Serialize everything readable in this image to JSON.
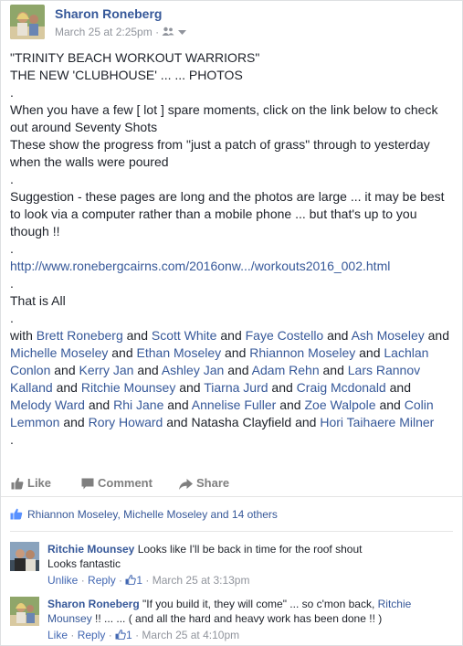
{
  "post": {
    "author": "Sharon Roneberg",
    "timestamp": "March 25 at 2:25pm",
    "privacy_sep": "·",
    "line1": "\"TRINITY BEACH WORKOUT WARRIORS\"",
    "line2": "THE NEW 'CLUBHOUSE' ... ... PHOTOS",
    "dot": ".",
    "para1": "When you have a few [ lot ] spare moments, click on the link below to check out around Seventy Shots",
    "para2": "These show the progress from \"just a patch of grass\" through to yesterday when the walls were poured",
    "para3": "Suggestion - these pages are long and the photos are large ... it may be best to look via a computer rather than a mobile phone ... but that's up to you though !!",
    "url": "http://www.ronebergcairns.com/2016onw.../workouts2016_002.html",
    "closing": "That is All",
    "with_label": "with",
    "and": "and",
    "tagged": [
      "Brett Roneberg",
      "Scott White",
      "Faye Costello",
      "Ash Moseley",
      "Michelle Moseley",
      "Ethan Moseley",
      "Rhiannon Moseley",
      "Lachlan Conlon",
      "Kerry Jan",
      "Ashley Jan",
      "Adam Rehn",
      "Lars Rannov Kalland",
      "Ritchie Mounsey",
      "Tiarna Jurd",
      "Craig Mcdonald",
      "Melody Ward",
      "Rhi Jane",
      "Annelise Fuller",
      "Zoe Walpole",
      "Colin Lemmon",
      "Rory Howard",
      "Natasha Clayfield",
      "Hori Taihaere Milner"
    ]
  },
  "actions": {
    "like": "Like",
    "comment": "Comment",
    "share": "Share"
  },
  "likes_summary": "Rhiannon Moseley, Michelle Moseley and 14 others",
  "comments": [
    {
      "name": "Ritchie Mounsey",
      "text1": "Looks like I'll be back in time for the roof shout",
      "text2": "Looks fantastic",
      "unlike": "Unlike",
      "reply": "Reply",
      "count": "1",
      "time": "March 25 at 3:13pm"
    },
    {
      "name": "Sharon Roneberg",
      "text1": "\"If you build it, they will come\" ... so c'mon back,",
      "mention": "Ritchie Mounsey",
      "text2": "!! ... ... ( and all the hard and heavy work has been done !! )",
      "like": "Like",
      "reply": "Reply",
      "count": "1",
      "time": "March 25 at 4:10pm"
    }
  ],
  "colors": {
    "link": "#365899",
    "meta": "#90949c",
    "text": "#1d2129"
  }
}
